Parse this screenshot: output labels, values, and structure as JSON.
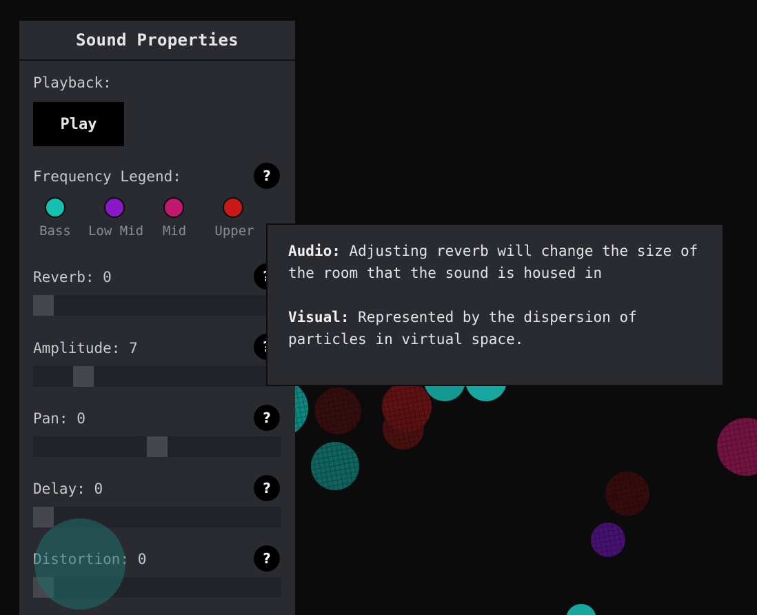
{
  "panel": {
    "title": "Sound Properties",
    "playback_label": "Playback:",
    "play_button": "Play",
    "legend_label": "Frequency Legend:",
    "help_glyph": "?",
    "legend": [
      {
        "label": "Bass",
        "color": "#14c0b0"
      },
      {
        "label": "Low Mid",
        "color": "#8a18c8"
      },
      {
        "label": "Mid",
        "color": "#c2186e"
      },
      {
        "label": "Upper",
        "color": "#c81818"
      }
    ],
    "controls": [
      {
        "label": "Reverb: 0",
        "value": 0,
        "min": 0,
        "max": 100
      },
      {
        "label": "Amplitude: 7",
        "value": 7,
        "min": 0,
        "max": 40
      },
      {
        "label": "Pan: 0",
        "value": 0,
        "min": -50,
        "max": 50
      },
      {
        "label": "Delay: 0",
        "value": 0,
        "min": 0,
        "max": 100
      },
      {
        "label": "Distortion: 0",
        "value": 0,
        "min": 0,
        "max": 100
      }
    ]
  },
  "tooltip": {
    "audio_title": "Audio:",
    "audio_text": " Adjusting reverb will change the size of the room that the sound is housed in",
    "visual_title": "Visual:",
    "visual_text": " Represented by the dispersion of particles in virtual space."
  },
  "colors": {
    "background": "#0b0b0b",
    "panel": "#2a2b31",
    "bass": "#14c0b0",
    "low_mid": "#8a18c8",
    "mid": "#c2186e",
    "upper": "#c81818"
  }
}
